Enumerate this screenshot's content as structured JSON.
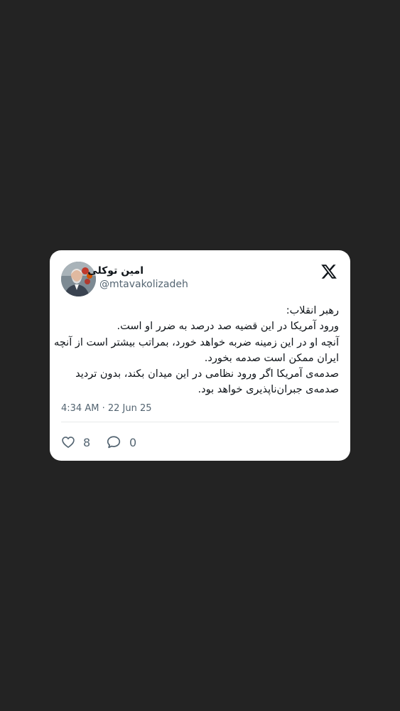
{
  "tweet": {
    "author": {
      "display_name": "امین توکلی",
      "handle": "@mtavakolizadeh"
    },
    "lines": [
      "رهبر انقلاب:",
      "ورود آمریکا در این قضیه صد درصد به ضرر او است.",
      "آنچه او در این زمینه ضربه خواهد خورد، بمراتب بیشتر است از آنچه",
      "ایران ممکن است صدمه بخورد.",
      "صدمه‌ی آمریکا اگر ورود نظامی در این میدان بکند، بدون تردید",
      "صدمه‌ی جبران‌ناپذیری خواهد بود."
    ],
    "timestamp": "4:34 AM · 22 Jun 25",
    "likes": "8",
    "replies": "0"
  },
  "icons": {
    "brand": "x-logo-icon",
    "like": "heart-icon",
    "reply": "speech-bubble-icon"
  },
  "colors": {
    "background": "#232323",
    "card": "#ffffff",
    "text_primary": "#0f1419",
    "text_secondary": "#536471"
  }
}
